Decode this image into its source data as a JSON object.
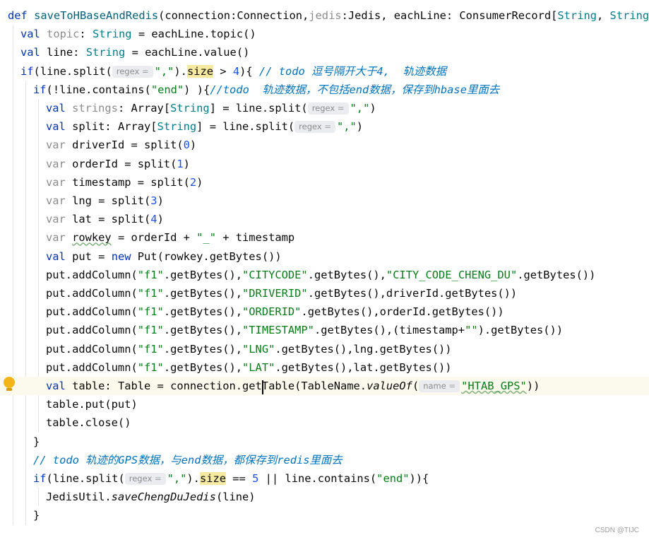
{
  "lines": [
    {
      "indent": 0,
      "spans": [
        {
          "t": "def ",
          "c": "kw"
        },
        {
          "t": "saveToHBaseAndRedis",
          "c": "fn"
        },
        {
          "t": "(connection:Connection,"
        },
        {
          "t": "jedis",
          "c": "dim"
        },
        {
          "t": ":Jedis, eachLine: ConsumerRecord["
        },
        {
          "t": "String",
          "c": "type"
        },
        {
          "t": ", "
        },
        {
          "t": "String",
          "c": "type"
        },
        {
          "t": "]):"
        }
      ]
    },
    {
      "indent": 1,
      "spans": [
        {
          "t": "val ",
          "c": "kw"
        },
        {
          "t": "topic",
          "c": "dim"
        },
        {
          "t": ": "
        },
        {
          "t": "String",
          "c": "type"
        },
        {
          "t": " = eachLine.topic()"
        }
      ]
    },
    {
      "indent": 1,
      "spans": [
        {
          "t": "val ",
          "c": "kw"
        },
        {
          "t": "line: "
        },
        {
          "t": "String",
          "c": "type"
        },
        {
          "t": " = eachLine.value()"
        }
      ]
    },
    {
      "indent": 1,
      "spans": [
        {
          "t": "if",
          "c": "kw"
        },
        {
          "t": "(line.split("
        },
        {
          "t": "regex",
          "c": "hint"
        },
        {
          "t": "\",\"",
          "c": "str"
        },
        {
          "t": ")."
        },
        {
          "t": "size",
          "c": "hl"
        },
        {
          "t": " > "
        },
        {
          "t": "4",
          "c": "num"
        },
        {
          "t": "){ "
        },
        {
          "t": "// todo 逗号隔开大于4,  轨迹数据",
          "c": "todo"
        }
      ]
    },
    {
      "indent": 2,
      "spans": [
        {
          "t": "if",
          "c": "kw"
        },
        {
          "t": "(!line.contains("
        },
        {
          "t": "\"end\"",
          "c": "str"
        },
        {
          "t": ") ){"
        },
        {
          "t": "//todo  轨迹数据，不包括end数据，保存到hbase里面去",
          "c": "todo"
        }
      ]
    },
    {
      "indent": 3,
      "spans": [
        {
          "t": "val ",
          "c": "kw"
        },
        {
          "t": "strings",
          "c": "dim"
        },
        {
          "t": ": Array["
        },
        {
          "t": "String",
          "c": "type"
        },
        {
          "t": "] = line.split("
        },
        {
          "t": "regex",
          "c": "hint"
        },
        {
          "t": "\",\"",
          "c": "str"
        },
        {
          "t": ")"
        }
      ]
    },
    {
      "indent": 3,
      "spans": [
        {
          "t": "val ",
          "c": "kw"
        },
        {
          "t": "split: Array["
        },
        {
          "t": "String",
          "c": "type"
        },
        {
          "t": "] = line.split("
        },
        {
          "t": "regex",
          "c": "hint"
        },
        {
          "t": "\",\"",
          "c": "str"
        },
        {
          "t": ")"
        }
      ]
    },
    {
      "indent": 3,
      "spans": [
        {
          "t": "var ",
          "c": "dim"
        },
        {
          "t": "driverId = split("
        },
        {
          "t": "0",
          "c": "num"
        },
        {
          "t": ")"
        }
      ]
    },
    {
      "indent": 3,
      "spans": [
        {
          "t": "var ",
          "c": "dim"
        },
        {
          "t": "orderId = split("
        },
        {
          "t": "1",
          "c": "num"
        },
        {
          "t": ")"
        }
      ]
    },
    {
      "indent": 3,
      "spans": [
        {
          "t": "var ",
          "c": "dim"
        },
        {
          "t": "timestamp = split("
        },
        {
          "t": "2",
          "c": "num"
        },
        {
          "t": ")"
        }
      ]
    },
    {
      "indent": 3,
      "spans": [
        {
          "t": "var ",
          "c": "dim"
        },
        {
          "t": "lng = split("
        },
        {
          "t": "3",
          "c": "num"
        },
        {
          "t": ")"
        }
      ]
    },
    {
      "indent": 3,
      "spans": [
        {
          "t": "var ",
          "c": "dim"
        },
        {
          "t": "lat = split("
        },
        {
          "t": "4",
          "c": "num"
        },
        {
          "t": ")"
        }
      ]
    },
    {
      "indent": 3,
      "spans": [
        {
          "t": "var ",
          "c": "dim"
        },
        {
          "t": "rowkey",
          "c": "squig"
        },
        {
          "t": " = orderId + "
        },
        {
          "t": "\"_\"",
          "c": "str"
        },
        {
          "t": " + timestamp"
        }
      ]
    },
    {
      "indent": 3,
      "spans": [
        {
          "t": "val ",
          "c": "kw"
        },
        {
          "t": "put = "
        },
        {
          "t": "new ",
          "c": "kw"
        },
        {
          "t": "Put(rowkey.getBytes())"
        }
      ]
    },
    {
      "indent": 3,
      "spans": [
        {
          "t": "put.addColumn("
        },
        {
          "t": "\"f1\"",
          "c": "str"
        },
        {
          "t": ".getBytes(),"
        },
        {
          "t": "\"CITYCODE\"",
          "c": "str"
        },
        {
          "t": ".getBytes(),"
        },
        {
          "t": "\"CITY_CODE_CHENG_DU\"",
          "c": "str"
        },
        {
          "t": ".getBytes())"
        }
      ]
    },
    {
      "indent": 3,
      "spans": [
        {
          "t": "put.addColumn("
        },
        {
          "t": "\"f1\"",
          "c": "str"
        },
        {
          "t": ".getBytes(),"
        },
        {
          "t": "\"DRIVERID\"",
          "c": "str"
        },
        {
          "t": ".getBytes(),driverId.getBytes())"
        }
      ]
    },
    {
      "indent": 3,
      "spans": [
        {
          "t": "put.addColumn("
        },
        {
          "t": "\"f1\"",
          "c": "str"
        },
        {
          "t": ".getBytes(),"
        },
        {
          "t": "\"ORDERID\"",
          "c": "str"
        },
        {
          "t": ".getBytes(),orderId.getBytes())"
        }
      ]
    },
    {
      "indent": 3,
      "spans": [
        {
          "t": "put.addColumn("
        },
        {
          "t": "\"f1\"",
          "c": "str"
        },
        {
          "t": ".getBytes(),"
        },
        {
          "t": "\"TIMESTAMP\"",
          "c": "str"
        },
        {
          "t": ".getBytes(),(timestamp+"
        },
        {
          "t": "\"\"",
          "c": "str"
        },
        {
          "t": ").getBytes())"
        }
      ]
    },
    {
      "indent": 3,
      "spans": [
        {
          "t": "put.addColumn("
        },
        {
          "t": "\"f1\"",
          "c": "str"
        },
        {
          "t": ".getBytes(),"
        },
        {
          "t": "\"LNG\"",
          "c": "str"
        },
        {
          "t": ".getBytes(),lng.getBytes())"
        }
      ]
    },
    {
      "indent": 3,
      "spans": [
        {
          "t": "put.addColumn("
        },
        {
          "t": "\"f1\"",
          "c": "str"
        },
        {
          "t": ".getBytes(),"
        },
        {
          "t": "\"LAT\"",
          "c": "str"
        },
        {
          "t": ".getBytes(),lat.getBytes())"
        }
      ]
    },
    {
      "indent": 3,
      "current": true,
      "spans": [
        {
          "t": "val ",
          "c": "kw"
        },
        {
          "t": "table: Table = connection.getT"
        },
        {
          "t": "able(TableName."
        },
        {
          "t": "valueOf",
          "c": "ital"
        },
        {
          "t": "("
        },
        {
          "t": "name",
          "c": "hint"
        },
        {
          "t": "\"HTAB_GPS\"",
          "c": "str squig"
        },
        {
          "t": "))"
        }
      ]
    },
    {
      "indent": 3,
      "spans": [
        {
          "t": "table.put(put)"
        }
      ]
    },
    {
      "indent": 3,
      "spans": [
        {
          "t": "table.close()"
        }
      ]
    },
    {
      "indent": 2,
      "spans": [
        {
          "t": "}"
        }
      ]
    },
    {
      "indent": 2,
      "spans": [
        {
          "t": "// todo 轨迹的GPS数据，与end数据，都保存到redis里面去",
          "c": "todo"
        }
      ]
    },
    {
      "indent": 2,
      "spans": [
        {
          "t": "if",
          "c": "kw"
        },
        {
          "t": "(line.split("
        },
        {
          "t": "regex",
          "c": "hint"
        },
        {
          "t": "\",\"",
          "c": "str"
        },
        {
          "t": ")."
        },
        {
          "t": "size",
          "c": "hl"
        },
        {
          "t": " == "
        },
        {
          "t": "5",
          "c": "num"
        },
        {
          "t": " || line.contains("
        },
        {
          "t": "\"end\"",
          "c": "str"
        },
        {
          "t": ")){"
        }
      ]
    },
    {
      "indent": 3,
      "spans": [
        {
          "t": "JedisUtil."
        },
        {
          "t": "saveChengDuJedis",
          "c": "ital"
        },
        {
          "t": "(line)"
        }
      ]
    },
    {
      "indent": 2,
      "spans": [
        {
          "t": "}"
        }
      ]
    }
  ],
  "watermark": "CSDN @TIJC",
  "icons": {
    "gutter": "lightbulb-icon"
  }
}
